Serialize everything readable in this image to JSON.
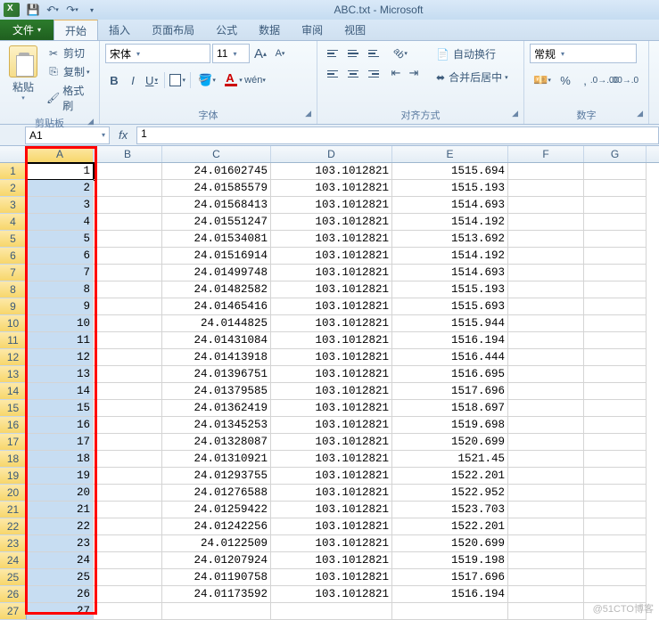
{
  "title": "ABC.txt - Microsoft",
  "qat": {
    "save": "💾",
    "undo": "↶",
    "redo": "↷"
  },
  "tabs": {
    "file": "文件",
    "items": [
      "开始",
      "插入",
      "页面布局",
      "公式",
      "数据",
      "审阅",
      "视图"
    ],
    "active": 0
  },
  "ribbon": {
    "clipboard": {
      "label": "剪贴板",
      "paste": "粘贴",
      "cut": "剪切",
      "copy": "复制",
      "format_painter": "格式刷"
    },
    "font": {
      "label": "字体",
      "name": "宋体",
      "size": "11",
      "grow": "A",
      "shrink": "A",
      "bold": "B",
      "italic": "I",
      "underline": "U"
    },
    "align": {
      "label": "对齐方式",
      "wrap": "自动换行",
      "merge": "合并后居中"
    },
    "number": {
      "label": "数字",
      "format": "常规",
      "currency": "¥",
      "percent": "%",
      "comma": ",",
      "inc": ".0",
      "dec": ".00"
    }
  },
  "formula_bar": {
    "cell": "A1",
    "fx": "fx",
    "value": "1"
  },
  "columns": [
    "A",
    "B",
    "C",
    "D",
    "E",
    "F",
    "G"
  ],
  "rows": [
    {
      "n": 1,
      "a": "1",
      "c": "24.01602745",
      "d": "103.1012821",
      "e": "1515.694"
    },
    {
      "n": 2,
      "a": "2",
      "c": "24.01585579",
      "d": "103.1012821",
      "e": "1515.193"
    },
    {
      "n": 3,
      "a": "3",
      "c": "24.01568413",
      "d": "103.1012821",
      "e": "1514.693"
    },
    {
      "n": 4,
      "a": "4",
      "c": "24.01551247",
      "d": "103.1012821",
      "e": "1514.192"
    },
    {
      "n": 5,
      "a": "5",
      "c": "24.01534081",
      "d": "103.1012821",
      "e": "1513.692"
    },
    {
      "n": 6,
      "a": "6",
      "c": "24.01516914",
      "d": "103.1012821",
      "e": "1514.192"
    },
    {
      "n": 7,
      "a": "7",
      "c": "24.01499748",
      "d": "103.1012821",
      "e": "1514.693"
    },
    {
      "n": 8,
      "a": "8",
      "c": "24.01482582",
      "d": "103.1012821",
      "e": "1515.193"
    },
    {
      "n": 9,
      "a": "9",
      "c": "24.01465416",
      "d": "103.1012821",
      "e": "1515.693"
    },
    {
      "n": 10,
      "a": "10",
      "c": "24.0144825",
      "d": "103.1012821",
      "e": "1515.944"
    },
    {
      "n": 11,
      "a": "11",
      "c": "24.01431084",
      "d": "103.1012821",
      "e": "1516.194"
    },
    {
      "n": 12,
      "a": "12",
      "c": "24.01413918",
      "d": "103.1012821",
      "e": "1516.444"
    },
    {
      "n": 13,
      "a": "13",
      "c": "24.01396751",
      "d": "103.1012821",
      "e": "1516.695"
    },
    {
      "n": 14,
      "a": "14",
      "c": "24.01379585",
      "d": "103.1012821",
      "e": "1517.696"
    },
    {
      "n": 15,
      "a": "15",
      "c": "24.01362419",
      "d": "103.1012821",
      "e": "1518.697"
    },
    {
      "n": 16,
      "a": "16",
      "c": "24.01345253",
      "d": "103.1012821",
      "e": "1519.698"
    },
    {
      "n": 17,
      "a": "17",
      "c": "24.01328087",
      "d": "103.1012821",
      "e": "1520.699"
    },
    {
      "n": 18,
      "a": "18",
      "c": "24.01310921",
      "d": "103.1012821",
      "e": "1521.45"
    },
    {
      "n": 19,
      "a": "19",
      "c": "24.01293755",
      "d": "103.1012821",
      "e": "1522.201"
    },
    {
      "n": 20,
      "a": "20",
      "c": "24.01276588",
      "d": "103.1012821",
      "e": "1522.952"
    },
    {
      "n": 21,
      "a": "21",
      "c": "24.01259422",
      "d": "103.1012821",
      "e": "1523.703"
    },
    {
      "n": 22,
      "a": "22",
      "c": "24.01242256",
      "d": "103.1012821",
      "e": "1522.201"
    },
    {
      "n": 23,
      "a": "23",
      "c": "24.0122509",
      "d": "103.1012821",
      "e": "1520.699"
    },
    {
      "n": 24,
      "a": "24",
      "c": "24.01207924",
      "d": "103.1012821",
      "e": "1519.198"
    },
    {
      "n": 25,
      "a": "25",
      "c": "24.01190758",
      "d": "103.1012821",
      "e": "1517.696"
    },
    {
      "n": 26,
      "a": "26",
      "c": "24.01173592",
      "d": "103.1012821",
      "e": "1516.194"
    },
    {
      "n": 27,
      "a": "27",
      "c": "",
      "d": "",
      "e": ""
    }
  ],
  "watermark": "@51CTO博客"
}
